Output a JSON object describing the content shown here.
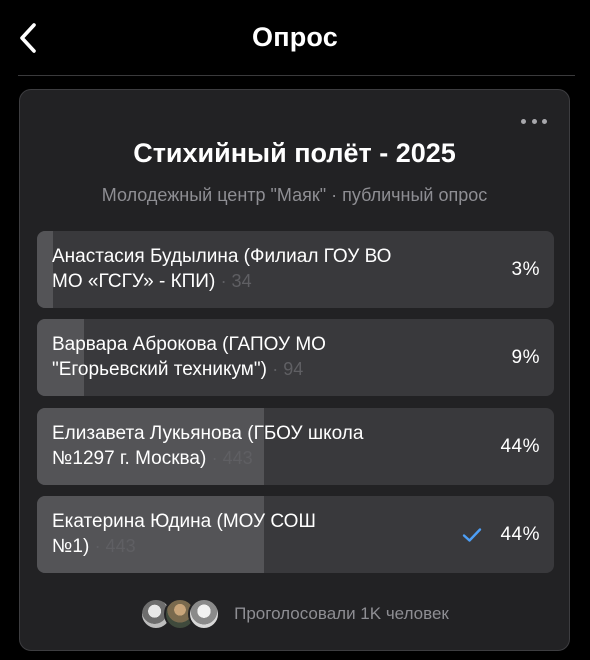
{
  "header": {
    "title": "Опрос"
  },
  "poll": {
    "title": "Стихийный полёт - 2025",
    "subtitle": "Молодежный центр \"Маяк\" · публичный опрос",
    "options": [
      {
        "label_line1": "Анастасия Будылина (Филиал ГОУ ВО",
        "label_line2": "МО «ГСГУ» - КПИ)",
        "votes": "· 34",
        "percent_text": "3%",
        "fill_fraction": 0.03,
        "selected": false
      },
      {
        "label_line1": "Варвара Аброкова (ГАПОУ МО",
        "label_line2": "\"Егорьевский техникум\")",
        "votes": "· 94",
        "percent_text": "9%",
        "fill_fraction": 0.09,
        "selected": false
      },
      {
        "label_line1": "Елизавета Лукьянова (ГБОУ школа",
        "label_line2": "№1297 г. Москва)",
        "votes": "· 443",
        "percent_text": "44%",
        "fill_fraction": 0.44,
        "selected": false
      },
      {
        "label_line1": "Екатерина Юдина (МОУ СОШ",
        "label_line2": "№1)",
        "votes": "· 443",
        "percent_text": "44%",
        "fill_fraction": 0.44,
        "selected": true
      }
    ],
    "footer_text": "Проголосовали 1K человек"
  },
  "icons": {
    "back": "chevron-left-icon",
    "more": "more-dots-icon",
    "check": "checkmark-icon"
  },
  "colors": {
    "background": "#000000",
    "card": "#222224",
    "option_bg": "#39393c",
    "option_fill": "#545457",
    "secondary_text": "#8e8e93",
    "accent": "#4d9ff7"
  }
}
